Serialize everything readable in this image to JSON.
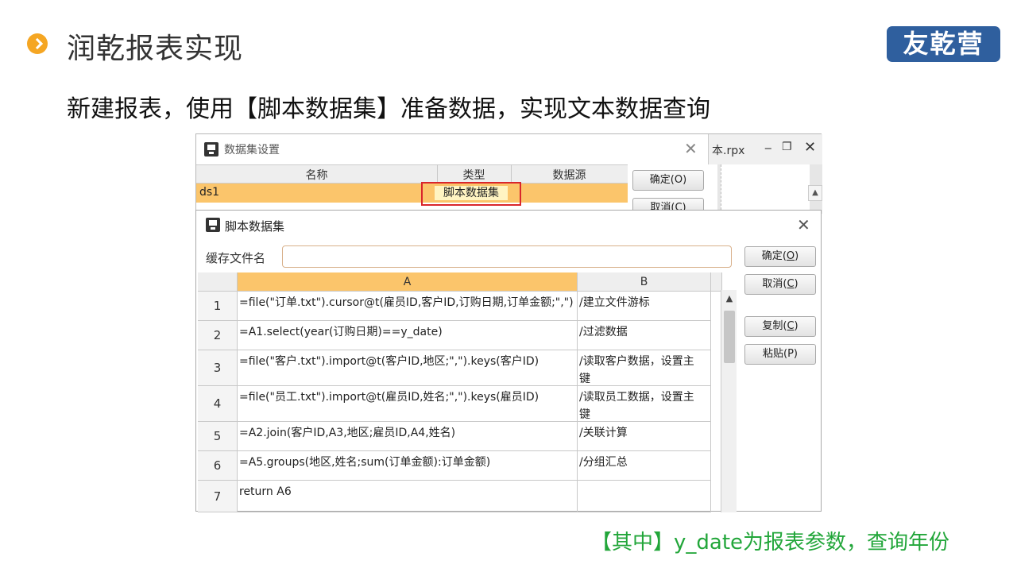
{
  "slide": {
    "title": "润乾报表实现",
    "logo": "友乾营",
    "subtitle": "新建报表，使用【脚本数据集】准备数据，实现文本数据查询",
    "footnote": "【其中】y_date为报表参数，查询年份"
  },
  "back_window": {
    "title": "数据集设置",
    "bg_tab": "本.rpx",
    "columns": [
      "名称",
      "类型",
      "数据源"
    ],
    "row": {
      "name": "ds1",
      "type": "脚本数据集",
      "source": ""
    },
    "ok": "确定(O)",
    "cancel": "取消(C)"
  },
  "dialog": {
    "title": "脚本数据集",
    "cache_label": "缓存文件名",
    "cache_value": "",
    "ok_label": "确定",
    "ok_key": "O",
    "cancel_label": "取消",
    "cancel_key": "C",
    "copy_label": "复制",
    "copy_key": "C",
    "paste_label": "粘贴",
    "paste_key": "P",
    "col_a": "A",
    "col_b": "B",
    "rows": [
      {
        "num": "1",
        "a": "=file(\"订单.txt\").cursor@t(雇员ID,客户ID,订购日期,订单金额;\",\")",
        "b": "/建立文件游标"
      },
      {
        "num": "2",
        "a": "=A1.select(year(订购日期)==y_date)",
        "b": "/过滤数据"
      },
      {
        "num": "3",
        "a": "=file(\"客户.txt\").import@t(客户ID,地区;\",\").keys(客户ID)",
        "b": "/读取客户数据，设置主键"
      },
      {
        "num": "4",
        "a": "=file(\"员工.txt\").import@t(雇员ID,姓名;\",\").keys(雇员ID)",
        "b": "/读取员工数据，设置主键"
      },
      {
        "num": "5",
        "a": "=A2.join(客户ID,A3,地区;雇员ID,A4,姓名)",
        "b": "/关联计算"
      },
      {
        "num": "6",
        "a": "=A5.groups(地区,姓名;sum(订单金额):订单金额)",
        "b": "/分组汇总"
      },
      {
        "num": "7",
        "a": "return A6",
        "b": ""
      }
    ]
  },
  "colors": {
    "accent_orange": "#f5a623",
    "selected_row": "#fbc56b",
    "logo_blue": "#2f5f9e",
    "footnote_green": "#22a63a",
    "highlight_red": "#d9262c"
  }
}
